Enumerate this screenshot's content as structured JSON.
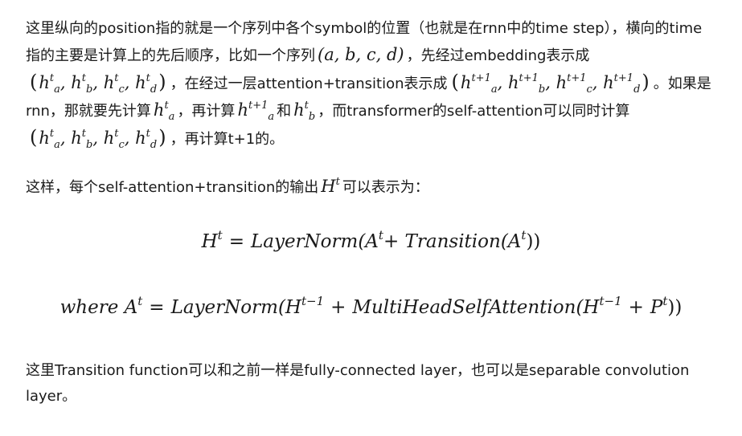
{
  "paragraph1": {
    "s1": "这里纵向的position指的就是一个序列中各个symbol的位置（也就是在rnn中的time step），横向的time指的主要是计算上的先后顺序，比如一个序列",
    "seq_abcd": "(a, b, c, d)",
    "s2": "，先经过embedding表示成",
    "s3": "，在经过一层attention+transition表示成",
    "s4": "。如果是rnn，那就要先计算",
    "s5": "，再计算",
    "s6": "和",
    "s7": "，而transformer的self-attention可以同时计算",
    "s8": "，再计算t+1的。"
  },
  "paragraph2": {
    "s1": "这样，每个self-attention+transition的输出",
    "s2": "可以表示为："
  },
  "equation1": {
    "lhs": "H",
    "lhs_sup": "t",
    "rhs": "LayerNorm(A",
    "rhs_sup": "t",
    "rhs2": "+ Transition(A",
    "rhs2_sup": "t",
    "rhs_end": "))"
  },
  "equation2": {
    "prefix": "where A",
    "prefix_sup": "t",
    "rhs": "LayerNorm(H",
    "rhs_sup": "t−1",
    "rhs2": "MultiHeadSelfAttention(H",
    "rhs2_sup": "t−1",
    "rhs3": "P",
    "rhs3_sup": "t",
    "rhs_end": "))"
  },
  "paragraph3": {
    "text": "这里Transition function可以和之前一样是fully-connected layer，也可以是separable convolution layer。"
  }
}
